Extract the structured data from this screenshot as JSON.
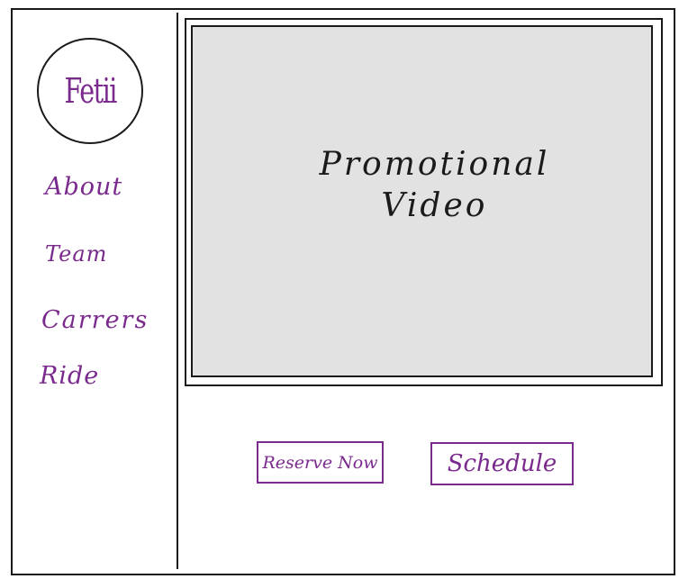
{
  "logo": {
    "text": "Fetii"
  },
  "sidebar": {
    "items": [
      {
        "label": "About"
      },
      {
        "label": "Team"
      },
      {
        "label": "Carrers"
      },
      {
        "label": "Ride"
      }
    ]
  },
  "main": {
    "video": {
      "line1": "Promotional",
      "line2": "Video"
    },
    "buttons": {
      "reserve_label": "Reserve Now",
      "schedule_label": "Schedule"
    }
  },
  "colors": {
    "accent": "#7a2a8c",
    "video_fill": "#e2e2e2",
    "line": "#1a1a1a"
  }
}
